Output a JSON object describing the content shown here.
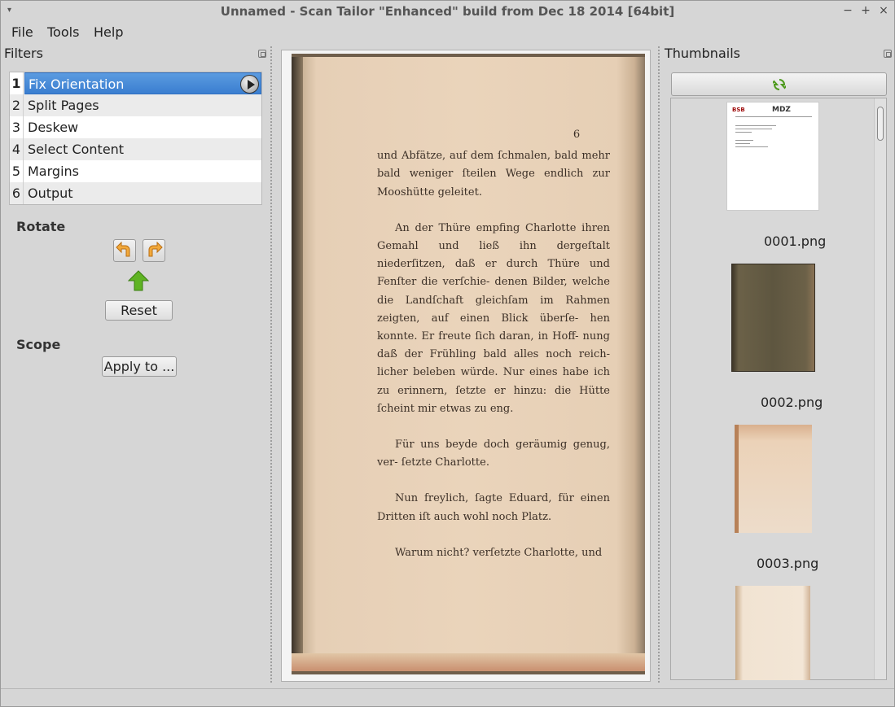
{
  "window": {
    "title": "Unnamed - Scan Tailor \"Enhanced\" build from Dec 18 2014 [64bit]",
    "min_glyph": "−",
    "max_glyph": "+",
    "close_glyph": "×",
    "menu_glyph": "▾"
  },
  "menubar": {
    "items": [
      "File",
      "Tools",
      "Help"
    ]
  },
  "filters": {
    "title": "Filters",
    "items": [
      {
        "num": "1",
        "label": "Fix Orientation"
      },
      {
        "num": "2",
        "label": "Split Pages"
      },
      {
        "num": "3",
        "label": "Deskew"
      },
      {
        "num": "4",
        "label": "Select Content"
      },
      {
        "num": "5",
        "label": "Margins"
      },
      {
        "num": "6",
        "label": "Output"
      }
    ],
    "selected_index": 0
  },
  "rotate": {
    "title": "Rotate",
    "reset_label": "Reset"
  },
  "scope": {
    "title": "Scope",
    "apply_label": "Apply to ..."
  },
  "page": {
    "page_number": "6",
    "paragraphs": [
      "und Abfätze, auf dem ſchmalen, bald mehr bald weniger ſteilen Wege endlich zur Mooshütte geleitet.",
      "An der Thüre empfing Charlotte ihren Gemahl und ließ ihn dergeſtalt niederſitzen, daß er durch Thüre und Fenſter die verſchie- denen Bilder, welche die Landſchaft gleichſam im Rahmen zeigten, auf einen Blick überſe- hen konnte. Er freute ſich daran, in Hoff- nung daß der Frühling bald alles noch reich- licher beleben würde. Nur eines habe ich zu erinnern, ſetzte er hinzu: die Hütte ſcheint mir etwas zu eng.",
      "Für uns beyde doch geräumig genug, ver- ſetzte Charlotte.",
      "Nun freylich, ſagte Eduard, für einen Dritten iſt auch wohl noch Platz.",
      "Warum nicht? verſetzte Charlotte, und"
    ]
  },
  "thumbnails": {
    "title": "Thumbnails",
    "items": [
      {
        "label": "0001.png",
        "logo_left": "BSB",
        "logo_right": "MDZ"
      },
      {
        "label": "0002.png"
      },
      {
        "label": "0003.png"
      }
    ]
  },
  "colors": {
    "selection": "#3a7ed0",
    "accent_arrow": "#f0a030",
    "up_arrow": "#59a520"
  }
}
